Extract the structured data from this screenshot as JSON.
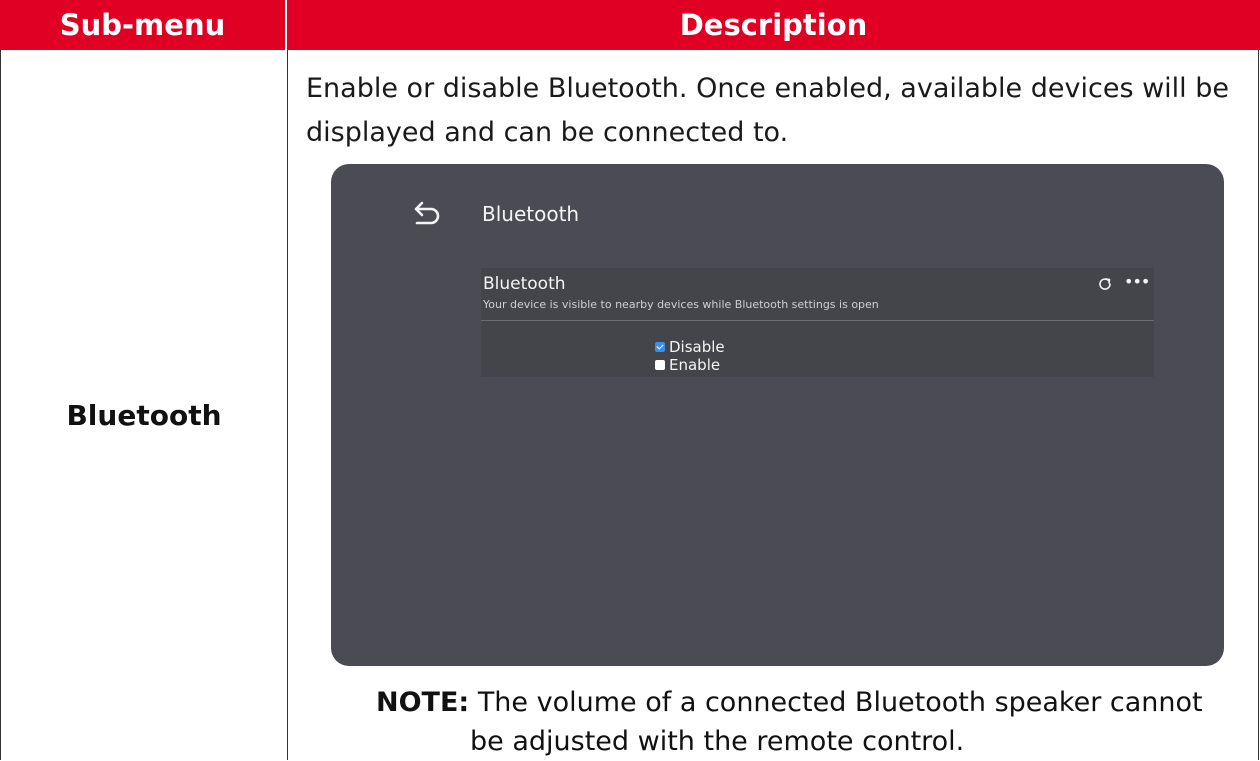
{
  "table": {
    "header_submenu": "Sub-menu",
    "header_description": "Description"
  },
  "row": {
    "submenu_name": "Bluetooth",
    "intro_text": "Enable or disable Bluetooth. Once enabled, available devices will be displayed and can be connected to.",
    "screen": {
      "title": "Bluetooth",
      "panel_title": "Bluetooth",
      "panel_subtitle": "Your device is visible to nearby devices while Bluetooth settings is open",
      "options": [
        {
          "label": "Disable",
          "checked": true
        },
        {
          "label": "Enable",
          "checked": false
        }
      ],
      "icons": [
        "back-arrow-icon",
        "refresh-icon",
        "more-icon"
      ]
    },
    "note_label": "NOTE:",
    "note_text_line1": "The volume of a connected Bluetooth speaker cannot",
    "note_text_line2": "be adjusted with the remote control."
  },
  "colors": {
    "header_red": "#df0024",
    "screen_bg": "#4b4b53",
    "checkbox_blue": "#3a8fe6"
  }
}
